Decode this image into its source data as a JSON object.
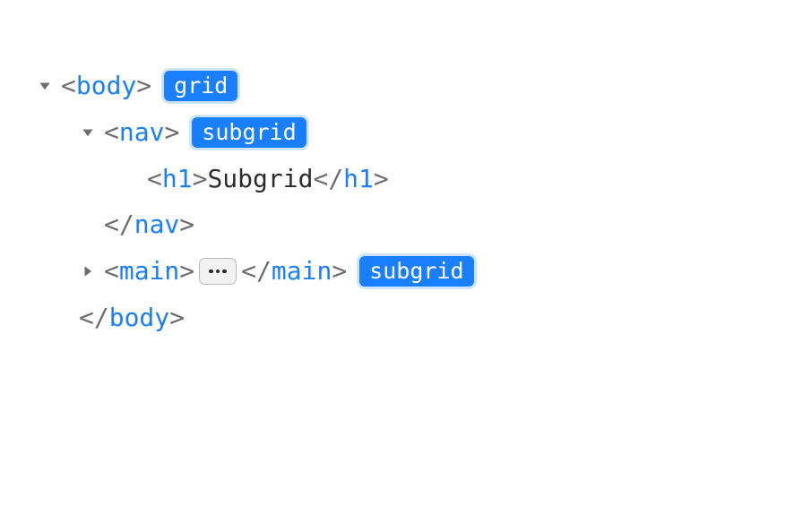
{
  "tree": {
    "row0": {
      "tag": "body",
      "badge": "grid"
    },
    "row1": {
      "tag": "nav",
      "badge": "subgrid"
    },
    "row2": {
      "tag": "h1",
      "text": "Subgrid"
    },
    "row3": {
      "tag": "nav"
    },
    "row4": {
      "tag": "main",
      "badge": "subgrid"
    },
    "row5": {
      "tag": "body"
    }
  }
}
